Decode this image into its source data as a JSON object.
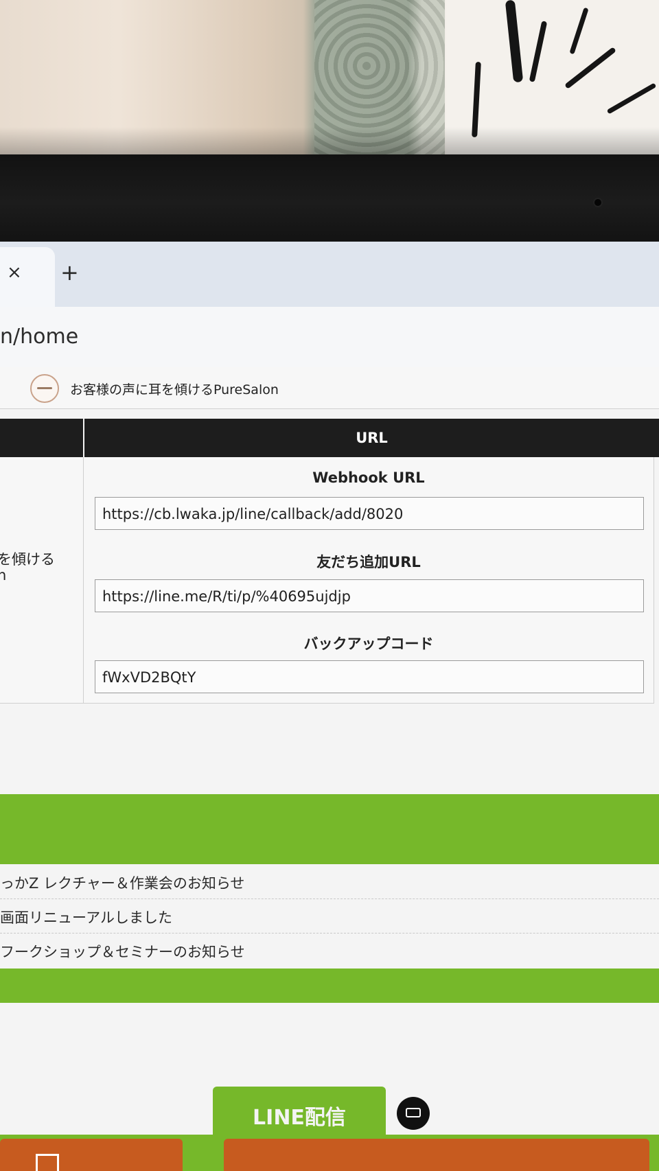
{
  "browser": {
    "tab_close_icon": "×",
    "new_tab_icon": "+",
    "address_text": "n/home"
  },
  "site": {
    "name": "お客様の声に耳を傾けるPureSalon"
  },
  "table": {
    "header": "URL",
    "left_cell_lines": [
      "を傾ける",
      "n"
    ],
    "fields": [
      {
        "label": "Webhook URL",
        "value": "https://cb.lwaka.jp/line/callback/add/8020"
      },
      {
        "label": "友だち追加URL",
        "value": "https://line.me/R/ti/p/%40695ujdjp"
      },
      {
        "label": "バックアップコード",
        "value": "fWxVD2BQtY"
      }
    ]
  },
  "news": {
    "items": [
      "っかZ レクチャー＆作業会のお知らせ",
      "画面リニューアルしました",
      "フークショップ＆セミナーのお知らせ"
    ]
  },
  "bottom": {
    "line_tab_label": "LINE配信",
    "book_icon": "book-icon"
  },
  "colors": {
    "accent_green": "#76b82a",
    "header_black": "#1d1d1d",
    "card_orange": "#c75b1f"
  }
}
